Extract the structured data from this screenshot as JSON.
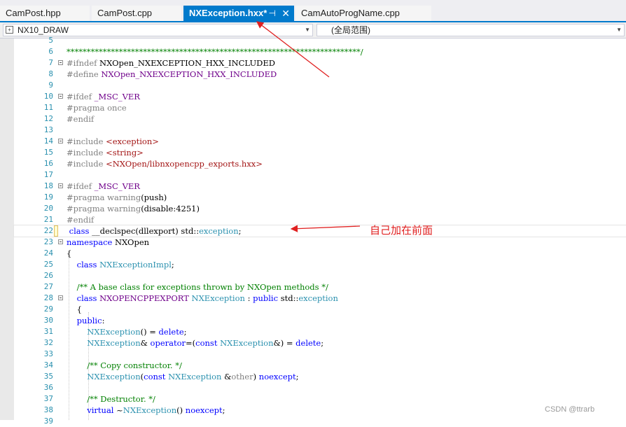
{
  "tabs": [
    {
      "label": "CamPost.hpp",
      "active": false
    },
    {
      "label": "CamPost.cpp",
      "active": false
    },
    {
      "label": "NXException.hxx*",
      "active": true
    },
    {
      "label": "CamAutoProgName.cpp",
      "active": false
    }
  ],
  "tab_icons": {
    "pin": "⊣",
    "close": "✕"
  },
  "navbar": {
    "project": "NX10_DRAW",
    "scope": "(全局范围)"
  },
  "annotation": "自己加在前面",
  "watermark": "CSDN @ttrarb",
  "lines": [
    {
      "n": "5",
      "html": ""
    },
    {
      "n": "6",
      "html": "<span class='c'>*************************************************************************/</span>"
    },
    {
      "n": "7",
      "html": "<span class='p'>#ifndef</span> NXOpen_NXEXCEPTION_HXX_INCLUDED",
      "fold": true
    },
    {
      "n": "8",
      "html": "<span class='p'>#define</span> <span class='m'>NXOpen_NXEXCEPTION_HXX_INCLUDED</span>"
    },
    {
      "n": "9",
      "html": ""
    },
    {
      "n": "10",
      "html": "<span class='p'>#ifdef</span> <span class='m'>_MSC_VER</span>",
      "fold": true
    },
    {
      "n": "11",
      "html": "<span class='p'>#pragma once</span>"
    },
    {
      "n": "12",
      "html": "<span class='p'>#endif</span>"
    },
    {
      "n": "13",
      "html": ""
    },
    {
      "n": "14",
      "html": "<span class='p'>#include</span> <span class='s'>&lt;exception&gt;</span>",
      "fold": true
    },
    {
      "n": "15",
      "html": "<span class='p'>#include</span> <span class='s'>&lt;string&gt;</span>"
    },
    {
      "n": "16",
      "html": "<span class='p'>#include</span> <span class='s'>&lt;NXOpen/libnxopencpp_exports.hxx&gt;</span>"
    },
    {
      "n": "17",
      "html": ""
    },
    {
      "n": "18",
      "html": "<span class='p'>#ifdef</span> <span class='m'>_MSC_VER</span>",
      "fold": true
    },
    {
      "n": "19",
      "html": "<span class='p'>#pragma warning</span>(push)"
    },
    {
      "n": "20",
      "html": "<span class='p'>#pragma warning</span>(disable:4251)"
    },
    {
      "n": "21",
      "html": "<span class='p'>#endif</span>"
    },
    {
      "n": "22",
      "html": " <span class='k'>class</span> __declspec(dllexport) std::<span class='t'>exception</span>;",
      "current": true
    },
    {
      "n": "23",
      "html": "<span class='k'>namespace</span> NXOpen",
      "fold": true
    },
    {
      "n": "24",
      "html": "{"
    },
    {
      "n": "25",
      "html": "    <span class='k'>class</span> <span class='t'>NXExceptionImpl</span>;"
    },
    {
      "n": "26",
      "html": ""
    },
    {
      "n": "27",
      "html": "    <span class='c'>/** A base class for exceptions thrown by NXOpen methods */</span>"
    },
    {
      "n": "28",
      "html": "    <span class='k'>class</span> <span class='m'>NXOPENCPPEXPORT</span> <span class='t'>NXException</span> : <span class='k'>public</span> std::<span class='t'>exception</span>",
      "fold": true
    },
    {
      "n": "29",
      "html": "    {"
    },
    {
      "n": "30",
      "html": "    <span class='k'>public</span>:"
    },
    {
      "n": "31",
      "html": "        <span class='t'>NXException</span>() = <span class='k'>delete</span>;"
    },
    {
      "n": "32",
      "html": "        <span class='t'>NXException</span>&amp; <span class='k'>operator</span>=(<span class='k'>const</span> <span class='t'>NXException</span>&amp;) = <span class='k'>delete</span>;"
    },
    {
      "n": "33",
      "html": ""
    },
    {
      "n": "34",
      "html": "        <span class='c'>/** Copy constructor. */</span>"
    },
    {
      "n": "35",
      "html": "        <span class='t'>NXException</span>(<span class='k'>const</span> <span class='t'>NXException</span> &amp;<span class='p'>other</span>) <span class='k'>noexcept</span>;"
    },
    {
      "n": "36",
      "html": ""
    },
    {
      "n": "37",
      "html": "        <span class='c'>/** Destructor. */</span>"
    },
    {
      "n": "38",
      "html": "        <span class='k'>virtual</span> ~<span class='t'>NXException</span>() <span class='k'>noexcept</span>;"
    },
    {
      "n": "39",
      "html": ""
    }
  ]
}
